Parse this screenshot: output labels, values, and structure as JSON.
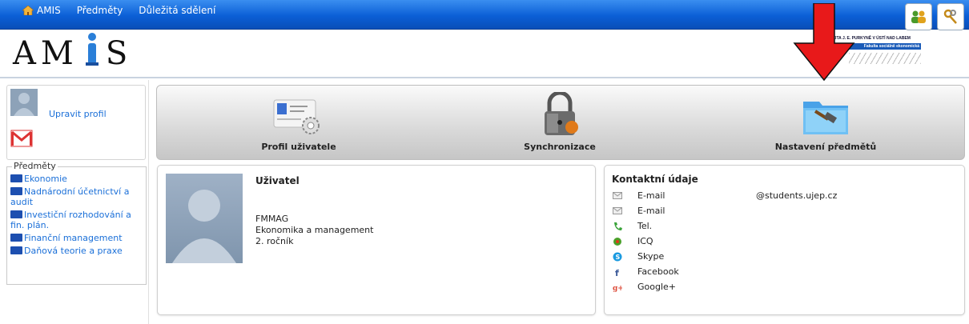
{
  "topnav": {
    "items": [
      {
        "label": "AMIS",
        "icon": "home-icon"
      },
      {
        "label": "Předměty"
      },
      {
        "label": "Důležitá sdělení"
      }
    ],
    "right_icons": [
      "users-icon",
      "keys-icon"
    ]
  },
  "header": {
    "logo_text_left": "AM",
    "logo_text_right": "S",
    "university_line": "ZITA J. E. PURKYNĚ V ÚSTÍ NAD LABEM",
    "faculty_line": "Fakulta sociálně ekonomická"
  },
  "sidebar": {
    "edit_profile": "Upravit profil",
    "subjects_title": "Předměty",
    "subjects": [
      "Ekonomie",
      "Nadnárodní účetnictví a audit",
      "Investiční rozhodování a fin. plán.",
      "Finanční management",
      "Daňová teorie a praxe"
    ]
  },
  "toolbar": {
    "profile_label": "Profil uživatele",
    "sync_label": "Synchronizace",
    "subjects_settings_label": "Nastavení předmětů"
  },
  "user_panel": {
    "title": "Uživatel",
    "lines": [
      "FMMAG",
      "Ekonomika a management",
      "2. ročník"
    ]
  },
  "contact_panel": {
    "title": "Kontaktní údaje",
    "rows": [
      {
        "label": "E-mail",
        "value": "@students.ujep.cz",
        "icon": "envelope-icon"
      },
      {
        "label": "E-mail",
        "value": "",
        "icon": "envelope-icon"
      },
      {
        "label": "Tel.",
        "value": "",
        "icon": "phone-icon"
      },
      {
        "label": "ICQ",
        "value": "",
        "icon": "icq-icon"
      },
      {
        "label": "Skype",
        "value": "",
        "icon": "skype-icon"
      },
      {
        "label": "Facebook",
        "value": "",
        "icon": "facebook-icon"
      },
      {
        "label": "Google+",
        "value": "",
        "icon": "google-plus-icon"
      }
    ]
  },
  "colors": {
    "topbar": "#0b5fd6",
    "link": "#1a6fd8",
    "arrow": "#e8191a"
  }
}
